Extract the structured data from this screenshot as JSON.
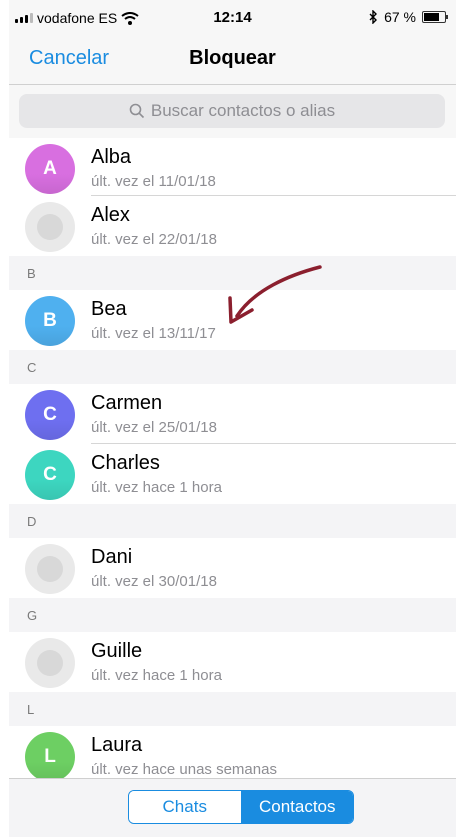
{
  "status_bar": {
    "carrier": "vodafone ES",
    "time": "12:14",
    "battery": "67 %",
    "battery_level": 0.67
  },
  "nav": {
    "cancel_label": "Cancelar",
    "title": "Bloquear"
  },
  "search": {
    "placeholder": "Buscar contactos o alias"
  },
  "sections": {
    "b": "B",
    "c": "C",
    "d": "D",
    "g": "G",
    "l": "L"
  },
  "contacts": [
    {
      "name": "Alba",
      "initial": "A",
      "last_seen": "últ. vez el 11/01/18",
      "color": "#d86fe0"
    },
    {
      "name": "Alex",
      "initial": "",
      "last_seen": "últ. vez el 22/01/18"
    },
    {
      "name": "Bea",
      "initial": "B",
      "last_seen": "últ. vez el 13/11/17",
      "color": "#4fb0ef"
    },
    {
      "name": "Carmen",
      "initial": "C",
      "last_seen": "últ. vez el 25/01/18",
      "color": "#6e6ff0"
    },
    {
      "name": "Charles",
      "initial": "C",
      "last_seen": "últ. vez hace 1 hora",
      "color": "#3dd6c0"
    },
    {
      "name": "Dani",
      "initial": "",
      "last_seen": "últ. vez el 30/01/18"
    },
    {
      "name": "Guille",
      "initial": "",
      "last_seen": "últ. vez hace 1 hora"
    },
    {
      "name": "Laura",
      "initial": "L",
      "last_seen": "últ. vez hace unas semanas",
      "color": "#6dcf63"
    }
  ],
  "tabs": {
    "chats": "Chats",
    "contactos": "Contactos",
    "selected": "Contactos"
  },
  "colors": {
    "accent": "#1a8ce0",
    "annotation_arrow": "#8b1f2e"
  },
  "icons": {
    "search": "magnifier-icon",
    "wifi": "wifi-icon",
    "bluetooth": "bluetooth-icon"
  }
}
